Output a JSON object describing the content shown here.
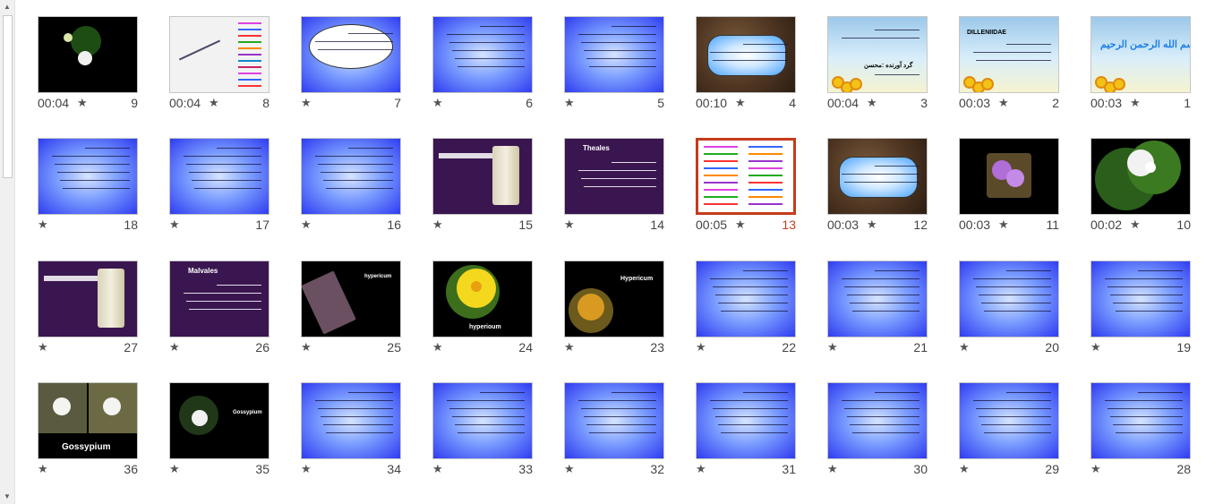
{
  "scrollbar": {
    "up_icon": "triangle-up",
    "down_icon": "triangle-down"
  },
  "star_glyph": "★",
  "slides": [
    {
      "num": "1",
      "timing": "00:03",
      "thumb": "sky-bismillah",
      "title": "بسم الله الرحمن الرحیم"
    },
    {
      "num": "2",
      "timing": "00:03",
      "thumb": "sky-dilleniidae",
      "title": "DILLENIIDAE"
    },
    {
      "num": "3",
      "timing": "00:04",
      "thumb": "sky-names",
      "title": "گرد آورنده :محسن"
    },
    {
      "num": "4",
      "timing": "00:10",
      "thumb": "brown-oval",
      "title": ""
    },
    {
      "num": "5",
      "timing": "",
      "thumb": "blue-text",
      "title": ""
    },
    {
      "num": "6",
      "timing": "",
      "thumb": "blue-text",
      "title": ""
    },
    {
      "num": "7",
      "timing": "",
      "thumb": "blue-bubble",
      "title": ""
    },
    {
      "num": "8",
      "timing": "00:04",
      "thumb": "gray-list",
      "title": ""
    },
    {
      "num": "9",
      "timing": "00:04",
      "thumb": "black-flower",
      "title": ""
    },
    {
      "num": "10",
      "timing": "00:02",
      "thumb": "green-flowers",
      "title": ""
    },
    {
      "num": "11",
      "timing": "00:03",
      "thumb": "black-purple-flowers",
      "title": ""
    },
    {
      "num": "12",
      "timing": "00:03",
      "thumb": "brown-oval",
      "title": ""
    },
    {
      "num": "13",
      "timing": "00:05",
      "thumb": "white-diagram",
      "title": "",
      "selected": true
    },
    {
      "num": "14",
      "timing": "",
      "thumb": "purple-list",
      "title": "Theales"
    },
    {
      "num": "15",
      "timing": "",
      "thumb": "purple-scroll",
      "title": ""
    },
    {
      "num": "16",
      "timing": "",
      "thumb": "blue-text",
      "title": ""
    },
    {
      "num": "17",
      "timing": "",
      "thumb": "blue-text",
      "title": ""
    },
    {
      "num": "18",
      "timing": "",
      "thumb": "blue-text",
      "title": ""
    },
    {
      "num": "19",
      "timing": "",
      "thumb": "blue-text",
      "title": ""
    },
    {
      "num": "20",
      "timing": "",
      "thumb": "blue-text",
      "title": ""
    },
    {
      "num": "21",
      "timing": "",
      "thumb": "blue-text",
      "title": ""
    },
    {
      "num": "22",
      "timing": "",
      "thumb": "blue-text",
      "title": ""
    },
    {
      "num": "23",
      "timing": "",
      "thumb": "black-hypericum-bush",
      "title": "Hypericum"
    },
    {
      "num": "24",
      "timing": "",
      "thumb": "black-yellow-flower",
      "title": "hyperioum"
    },
    {
      "num": "25",
      "timing": "",
      "thumb": "black-hypericum-tilted",
      "title": "hypericum"
    },
    {
      "num": "26",
      "timing": "",
      "thumb": "purple-list",
      "title": "Malvales"
    },
    {
      "num": "27",
      "timing": "",
      "thumb": "purple-scroll",
      "title": ""
    },
    {
      "num": "28",
      "timing": "",
      "thumb": "blue-text",
      "title": ""
    },
    {
      "num": "29",
      "timing": "",
      "thumb": "blue-text",
      "title": ""
    },
    {
      "num": "30",
      "timing": "",
      "thumb": "blue-text",
      "title": ""
    },
    {
      "num": "31",
      "timing": "",
      "thumb": "blue-text",
      "title": ""
    },
    {
      "num": "32",
      "timing": "",
      "thumb": "blue-text",
      "title": ""
    },
    {
      "num": "33",
      "timing": "",
      "thumb": "blue-text",
      "title": ""
    },
    {
      "num": "34",
      "timing": "",
      "thumb": "blue-text",
      "title": ""
    },
    {
      "num": "35",
      "timing": "",
      "thumb": "black-gossypium-flower",
      "title": "Gossypium"
    },
    {
      "num": "36",
      "timing": "",
      "thumb": "black-gossypium-cotton",
      "title": "Gossypium"
    }
  ]
}
